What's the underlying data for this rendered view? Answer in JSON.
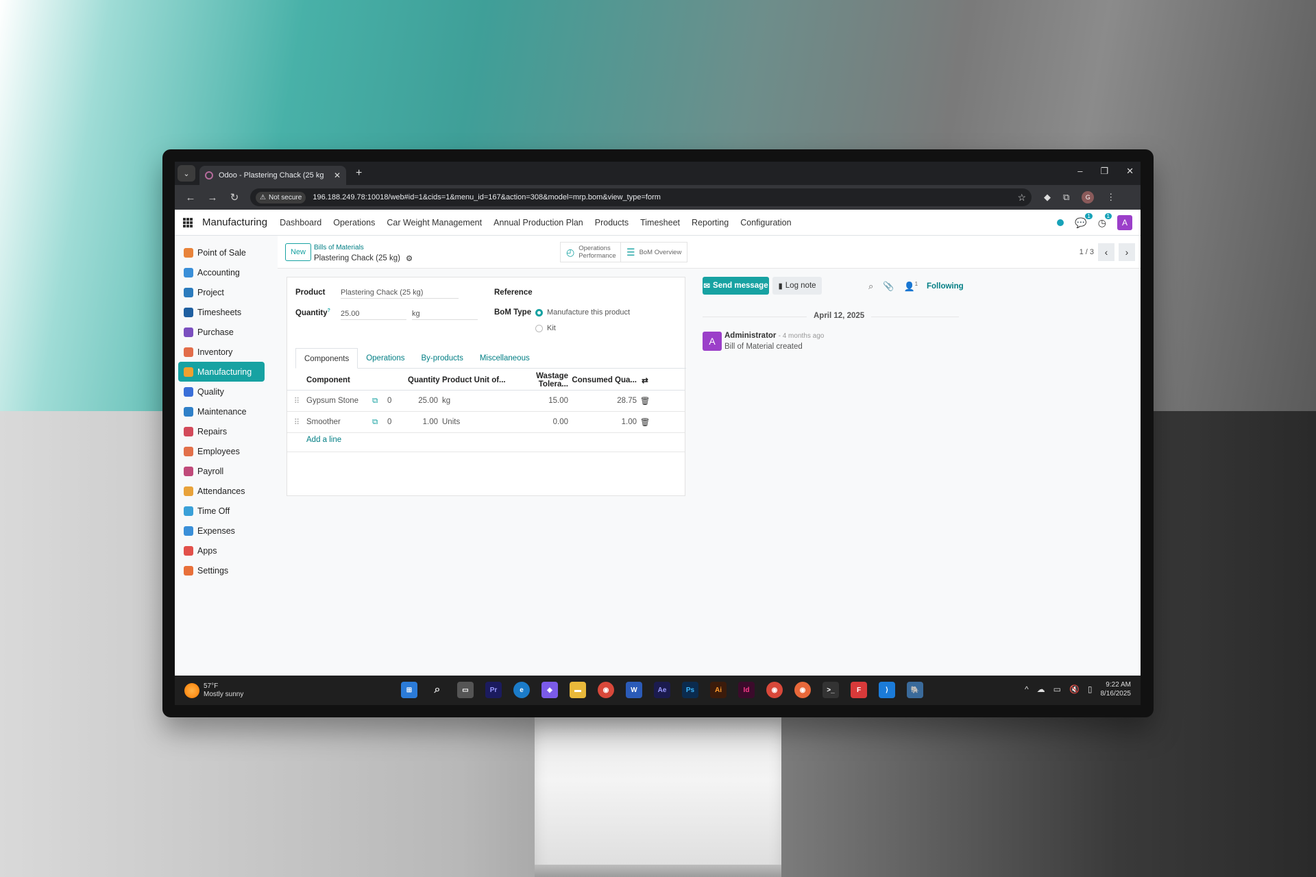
{
  "browser": {
    "tab_title": "Odoo - Plastering Chack (25 kg",
    "not_secure": "Not secure",
    "url": "196.188.249.78:10018/web#id=1&cids=1&menu_id=167&action=308&model=mrp.bom&view_type=form",
    "profile_initial": "G"
  },
  "topnav": {
    "app_name": "Manufacturing",
    "menu": [
      "Dashboard",
      "Operations",
      "Car Weight Management",
      "Annual Production Plan",
      "Products",
      "Timesheet",
      "Reporting",
      "Configuration"
    ],
    "chat_badge": "1",
    "activity_badge": "1",
    "user_initial": "A"
  },
  "sidebar": {
    "items": [
      {
        "label": "Point of Sale",
        "color": "#e8833a"
      },
      {
        "label": "Accounting",
        "color": "#3a8fd8"
      },
      {
        "label": "Project",
        "color": "#2b7bbd"
      },
      {
        "label": "Timesheets",
        "color": "#1f5fa0"
      },
      {
        "label": "Purchase",
        "color": "#7b4fbf"
      },
      {
        "label": "Inventory",
        "color": "#e26d4a"
      },
      {
        "label": "Manufacturing",
        "color": "#f0a030"
      },
      {
        "label": "Quality",
        "color": "#3a6fd8"
      },
      {
        "label": "Maintenance",
        "color": "#2f80c8"
      },
      {
        "label": "Repairs",
        "color": "#d24a5a"
      },
      {
        "label": "Employees",
        "color": "#e2704a"
      },
      {
        "label": "Payroll",
        "color": "#c04a7a"
      },
      {
        "label": "Attendances",
        "color": "#e8a23a"
      },
      {
        "label": "Time Off",
        "color": "#3aa0d8"
      },
      {
        "label": "Expenses",
        "color": "#3a8fd8"
      },
      {
        "label": "Apps",
        "color": "#e2504a"
      },
      {
        "label": "Settings",
        "color": "#e8703a"
      }
    ],
    "active_index": 6
  },
  "controlpanel": {
    "new_label": "New",
    "breadcrumb_parent": "Bills of Materials",
    "breadcrumb_current": "Plastering Chack (25 kg)",
    "smart_ops_line1": "Operations",
    "smart_ops_line2": "Performance",
    "smart_bom": "BoM Overview",
    "pager": "1 / 3"
  },
  "form": {
    "product_label": "Product",
    "product_value": "Plastering Chack (25 kg)",
    "quantity_label": "Quantity",
    "quantity_value": "25.00",
    "quantity_uom": "kg",
    "reference_label": "Reference",
    "bom_type_label": "BoM Type",
    "bom_type_options": [
      "Manufacture this product",
      "Kit"
    ],
    "bom_type_selected": 0,
    "tabs": [
      "Components",
      "Operations",
      "By-products",
      "Miscellaneous"
    ],
    "active_tab": 0,
    "columns": {
      "component": "Component",
      "quantity": "Quantity",
      "uom": "Product Unit of...",
      "wastage": "Wastage Tolera...",
      "consumed": "Consumed Qua..."
    },
    "rows": [
      {
        "component": "Gypsum Stone",
        "stock": "0",
        "quantity": "25.00",
        "uom": "kg",
        "wastage": "15.00",
        "consumed": "28.75"
      },
      {
        "component": "Smoother",
        "stock": "0",
        "quantity": "1.00",
        "uom": "Units",
        "wastage": "0.00",
        "consumed": "1.00"
      }
    ],
    "add_line": "Add a line"
  },
  "chatter": {
    "send_message": "Send message",
    "log_note": "Log note",
    "followers_count": "1",
    "following": "Following",
    "date": "April 12, 2025",
    "author_initial": "A",
    "author": "Administrator",
    "time": "- 4 months ago",
    "body": "Bill of Material created"
  },
  "taskbar": {
    "temperature": "57°F",
    "weather": "Mostly sunny",
    "time": "9:22 AM",
    "date": "8/16/2025"
  }
}
